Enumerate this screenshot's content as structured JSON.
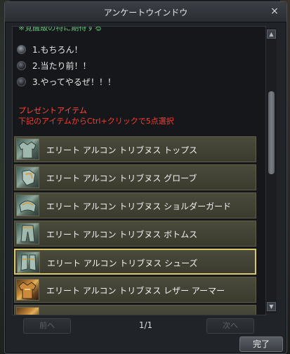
{
  "window": {
    "title": "アンケートウインドウ",
    "close_glyph": "×"
  },
  "survey": {
    "cut_heading": "※覚醒級の特に期待する",
    "options": [
      {
        "label": "1.もちろん！",
        "selected": true
      },
      {
        "label": "2.当たり前！！",
        "selected": false
      },
      {
        "label": "3.やってやるぜ！！！",
        "selected": false
      }
    ]
  },
  "present": {
    "title": "プレゼントアイテム",
    "description": "下記のアイテムからCtrl+クリックで5点選択"
  },
  "items": [
    {
      "name": "エリート アルコン トリブヌス トップス",
      "icon": "armor-top-icon",
      "selected": false
    },
    {
      "name": "エリート アルコン トリブヌス グローブ",
      "icon": "gloves-icon",
      "selected": false
    },
    {
      "name": "エリート アルコン トリブヌス ショルダーガード",
      "icon": "shoulder-guard-icon",
      "selected": false
    },
    {
      "name": "エリート アルコン トリブヌス ボトムス",
      "icon": "pants-icon",
      "selected": false
    },
    {
      "name": "エリート アルコン トリブヌス シューズ",
      "icon": "shoes-icon",
      "selected": true
    },
    {
      "name": "エリート アルコン トリブヌス レザー アーマー",
      "icon": "leather-armor-icon",
      "selected": false
    }
  ],
  "pager": {
    "prev_label": "前へ",
    "next_label": "次へ",
    "page_indicator": "1/1"
  },
  "done_label": "完了",
  "colors": {
    "accent_gold": "#d9c86a",
    "present_red": "#ff3b2e",
    "cut_text_green": "#68c47a"
  }
}
